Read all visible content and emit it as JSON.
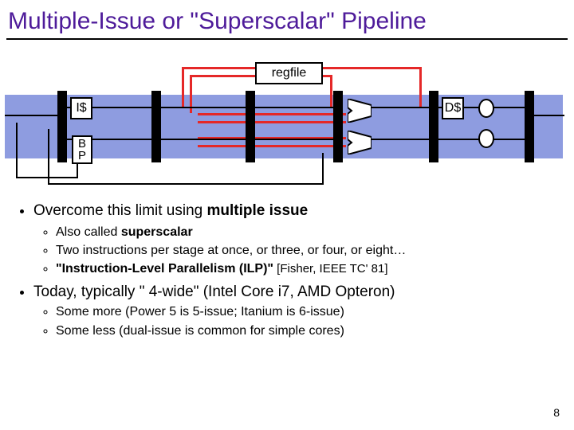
{
  "title": "Multiple-Issue or \"Superscalar\" Pipeline",
  "diagram": {
    "regfile": "regfile",
    "iCache": "I$",
    "dCache": "D$",
    "bp1": "B",
    "bp2": "P"
  },
  "bullets": {
    "l1a_pre": "Overcome this limit using ",
    "l1a_b": "multiple issue",
    "l2a_pre": "Also called ",
    "l2a_b": "superscalar",
    "l2b": "Two instructions per stage at once, or three, or four, or eight…",
    "l2c_b": "\"Instruction-Level Parallelism (ILP)\"",
    "l2c_cite": " [Fisher, IEEE TC' 81]",
    "l1b": "Today, typically \" 4-wide\" (Intel Core i7, AMD Opteron)",
    "l3a": "Some more (Power 5 is 5-issue; Itanium is 6-issue)",
    "l3b": "Some less (dual-issue is common for simple cores)"
  },
  "pagenum": "8"
}
